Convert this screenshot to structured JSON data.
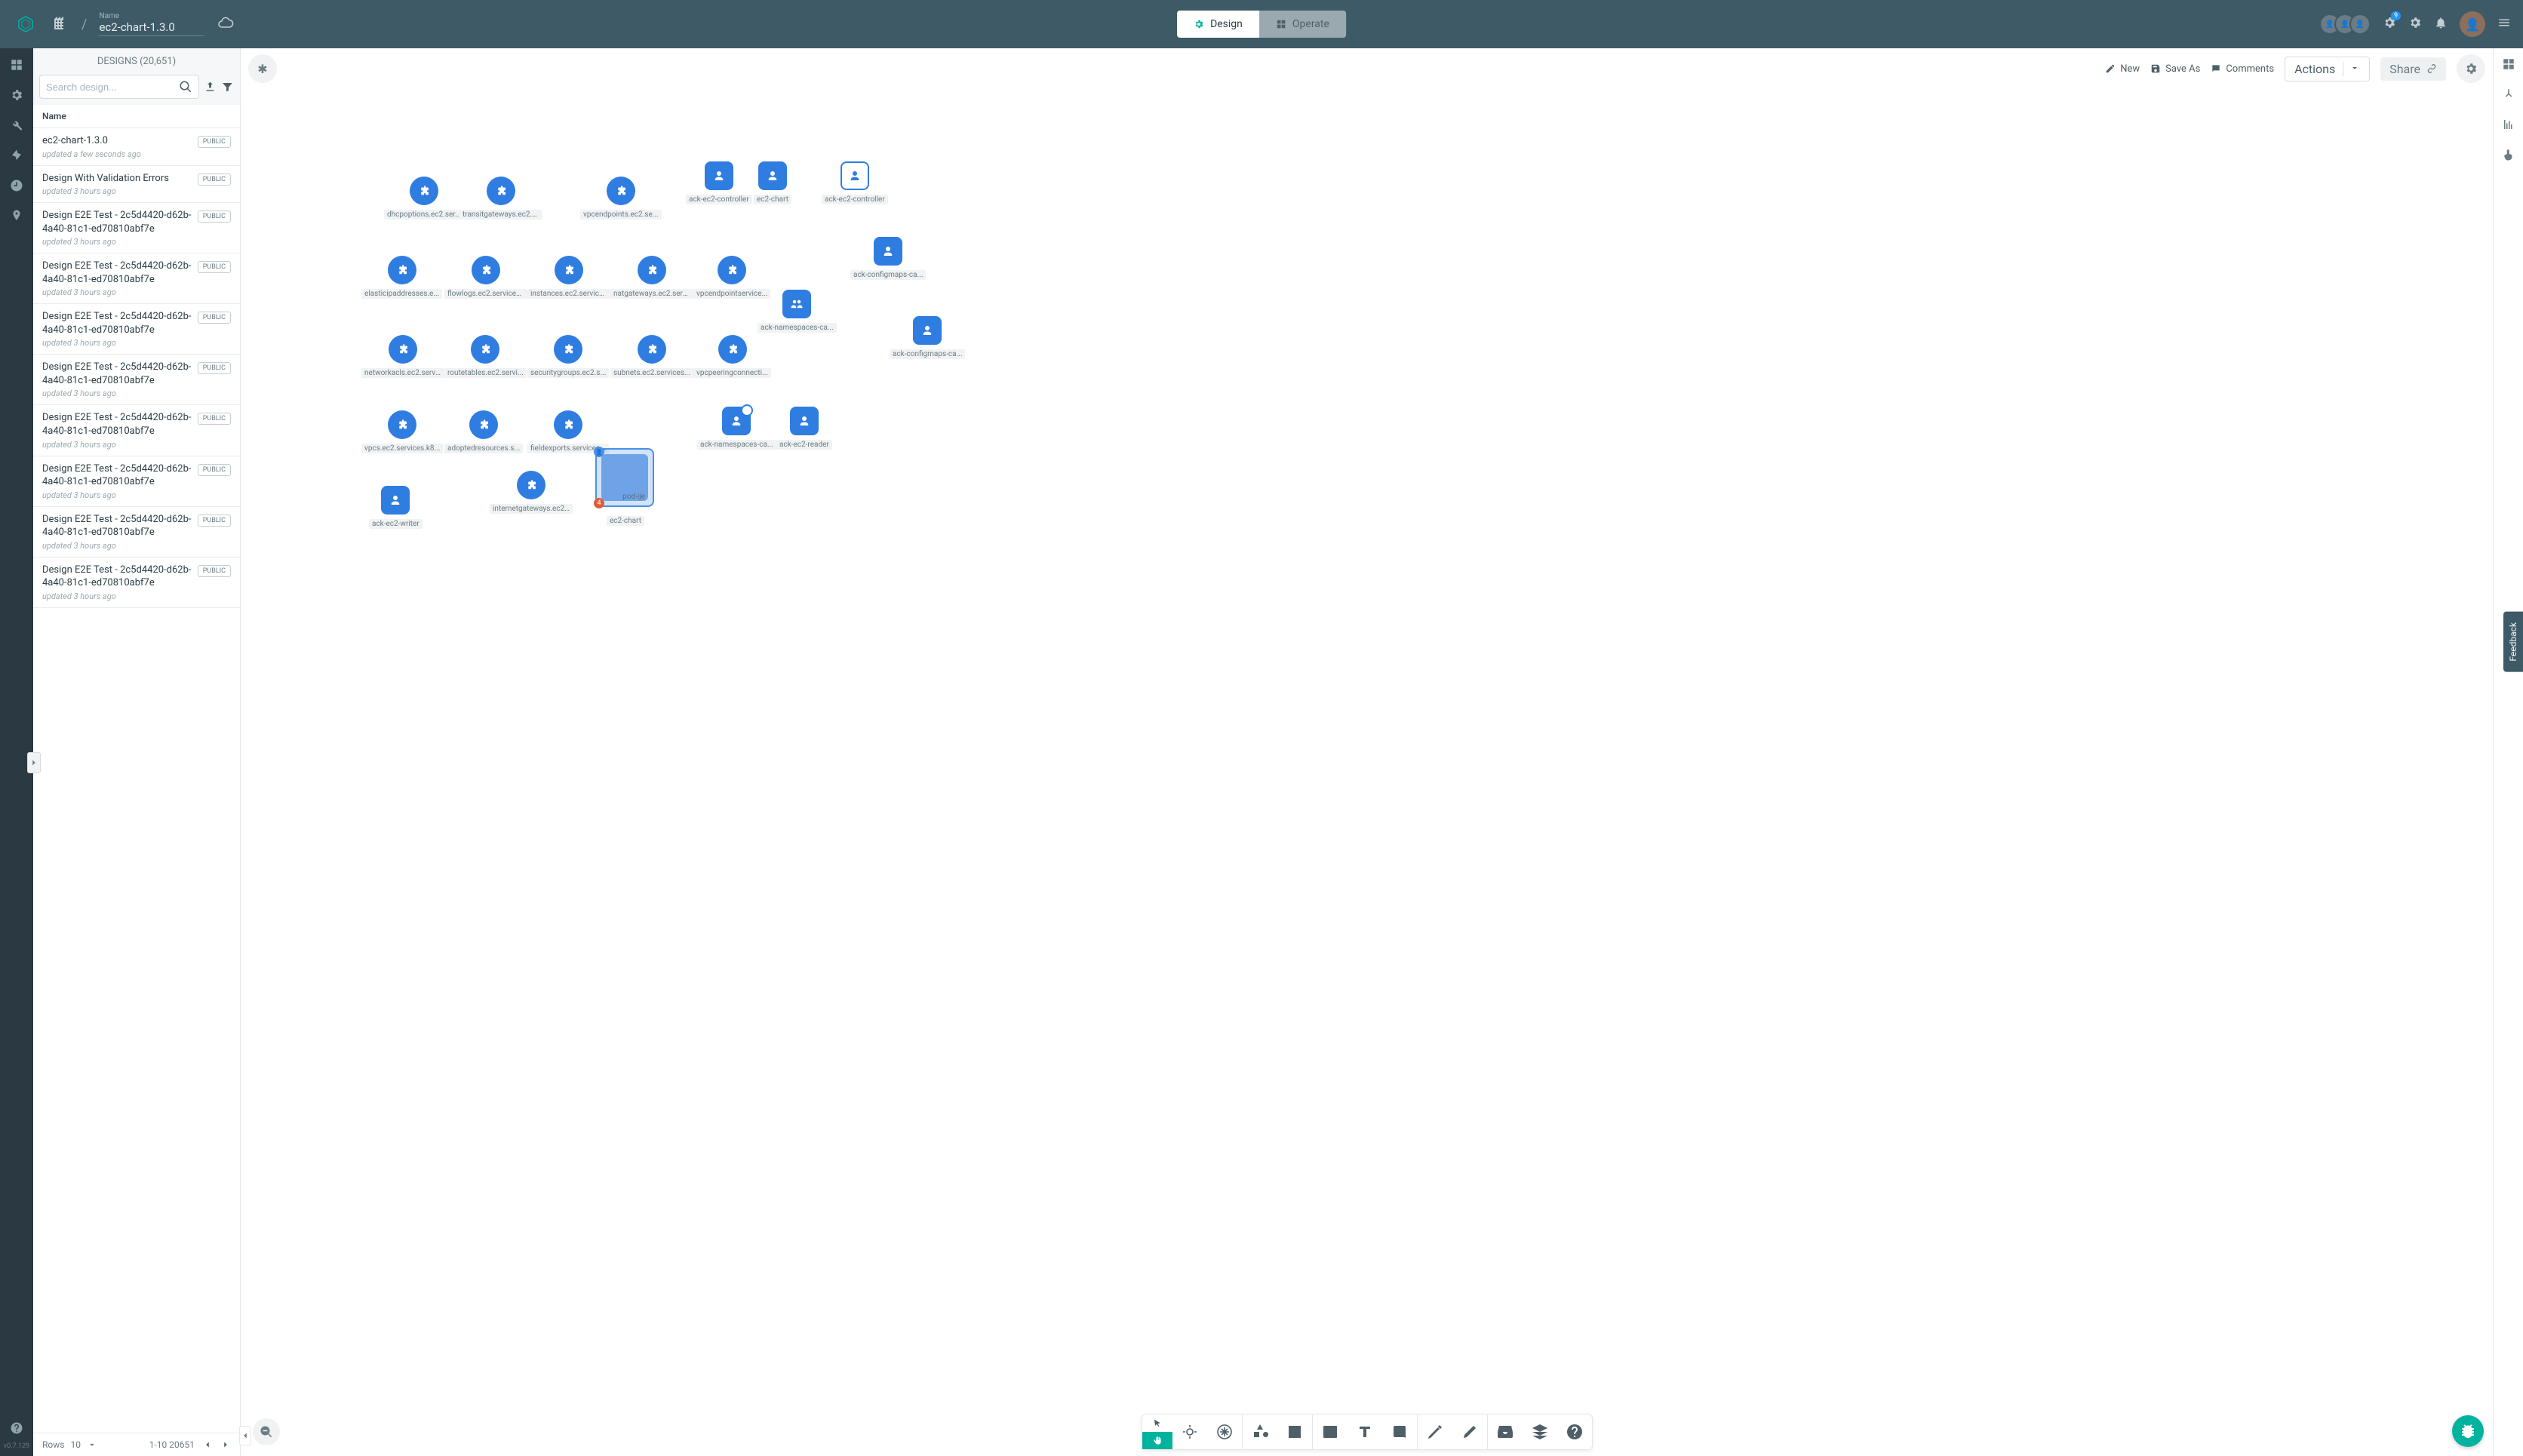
{
  "header": {
    "name_label": "Name",
    "name_value": "ec2-chart-1.3.0",
    "tabs": {
      "design": "Design",
      "operate": "Operate"
    },
    "notification_count": "9"
  },
  "rail": {
    "version": "v0.7.129"
  },
  "sidebar": {
    "title": "DESIGNS (20,651)",
    "search_placeholder": "Search design...",
    "name_header": "Name",
    "items": [
      {
        "title": "ec2-chart-1.3.0",
        "sub": "updated a few seconds ago",
        "badge": "PUBLIC"
      },
      {
        "title": "Design With Validation Errors",
        "sub": "updated 3 hours ago",
        "badge": "PUBLIC"
      },
      {
        "title": "Design E2E Test - 2c5d4420-d62b-4a40-81c1-ed70810abf7e",
        "sub": "updated 3 hours ago",
        "badge": "PUBLIC"
      },
      {
        "title": "Design E2E Test - 2c5d4420-d62b-4a40-81c1-ed70810abf7e",
        "sub": "updated 3 hours ago",
        "badge": "PUBLIC"
      },
      {
        "title": "Design E2E Test - 2c5d4420-d62b-4a40-81c1-ed70810abf7e",
        "sub": "updated 3 hours ago",
        "badge": "PUBLIC"
      },
      {
        "title": "Design E2E Test - 2c5d4420-d62b-4a40-81c1-ed70810abf7e",
        "sub": "updated 3 hours ago",
        "badge": "PUBLIC"
      },
      {
        "title": "Design E2E Test - 2c5d4420-d62b-4a40-81c1-ed70810abf7e",
        "sub": "updated 3 hours ago",
        "badge": "PUBLIC"
      },
      {
        "title": "Design E2E Test - 2c5d4420-d62b-4a40-81c1-ed70810abf7e",
        "sub": "updated 3 hours ago",
        "badge": "PUBLIC"
      },
      {
        "title": "Design E2E Test - 2c5d4420-d62b-4a40-81c1-ed70810abf7e",
        "sub": "updated 3 hours ago",
        "badge": "PUBLIC"
      },
      {
        "title": "Design E2E Test - 2c5d4420-d62b-4a40-81c1-ed70810abf7e",
        "sub": "updated 3 hours ago",
        "badge": "PUBLIC"
      }
    ],
    "pagination": {
      "rows_label": "Rows",
      "rows_value": "10",
      "range": "1-10 20651"
    }
  },
  "canvas_actions": {
    "new": "New",
    "save_as": "Save As",
    "comments": "Comments",
    "actions": "Actions",
    "share": "Share"
  },
  "nodes": {
    "r1": [
      {
        "label": "dhcpoptions.ec2.ser...",
        "type": "puzzle"
      },
      {
        "label": "transitgateways.ec2.s...",
        "type": "puzzle"
      },
      {
        "label": "vpcendpoints.ec2.se...",
        "type": "puzzle"
      },
      {
        "label": "ack-ec2-controller",
        "type": "user-sq"
      },
      {
        "label": "ec2-chart",
        "type": "user-sq"
      },
      {
        "label": "ack-ec2-controller",
        "type": "user-sq-outline"
      }
    ],
    "r2": [
      {
        "label": "elasticipaddresses.e...",
        "type": "puzzle"
      },
      {
        "label": "flowlogs.ec2.services...",
        "type": "puzzle"
      },
      {
        "label": "instances.ec2.service...",
        "type": "puzzle"
      },
      {
        "label": "natgateways.ec2.serv...",
        "type": "puzzle"
      },
      {
        "label": "vpcendpointservice...",
        "type": "puzzle"
      },
      {
        "label": "ack-configmaps-ca...",
        "type": "user-sq"
      }
    ],
    "r2b": {
      "label": "ack-namespaces-ca...",
      "type": "users-sq"
    },
    "r3": [
      {
        "label": "networkacls.ec2.servi...",
        "type": "puzzle"
      },
      {
        "label": "routetables.ec2.servi...",
        "type": "puzzle"
      },
      {
        "label": "securitygroups.ec2.s...",
        "type": "puzzle"
      },
      {
        "label": "subnets.ec2.services...",
        "type": "puzzle"
      },
      {
        "label": "vpcpeeringconnecti...",
        "type": "puzzle"
      },
      {
        "label": "ack-configmaps-ca...",
        "type": "user-sq"
      }
    ],
    "r4": [
      {
        "label": "vpcs.ec2.services.k8...",
        "type": "puzzle"
      },
      {
        "label": "adoptedresources.s...",
        "type": "puzzle"
      },
      {
        "label": "fieldexports.services...",
        "type": "puzzle"
      },
      {
        "label": "ack-namespaces-ca...",
        "type": "user-sq-dbl"
      },
      {
        "label": "ack-ec2-reader",
        "type": "user-sq"
      }
    ],
    "r5": [
      {
        "label": "ack-ec2-writer",
        "type": "user-sq"
      },
      {
        "label": "internetgateways.ec2...",
        "type": "puzzle"
      }
    ],
    "selected": {
      "inner_label": "pod-ije",
      "outer_label": "ec2-chart",
      "error_count": "4"
    }
  },
  "feedback": "Feedback"
}
